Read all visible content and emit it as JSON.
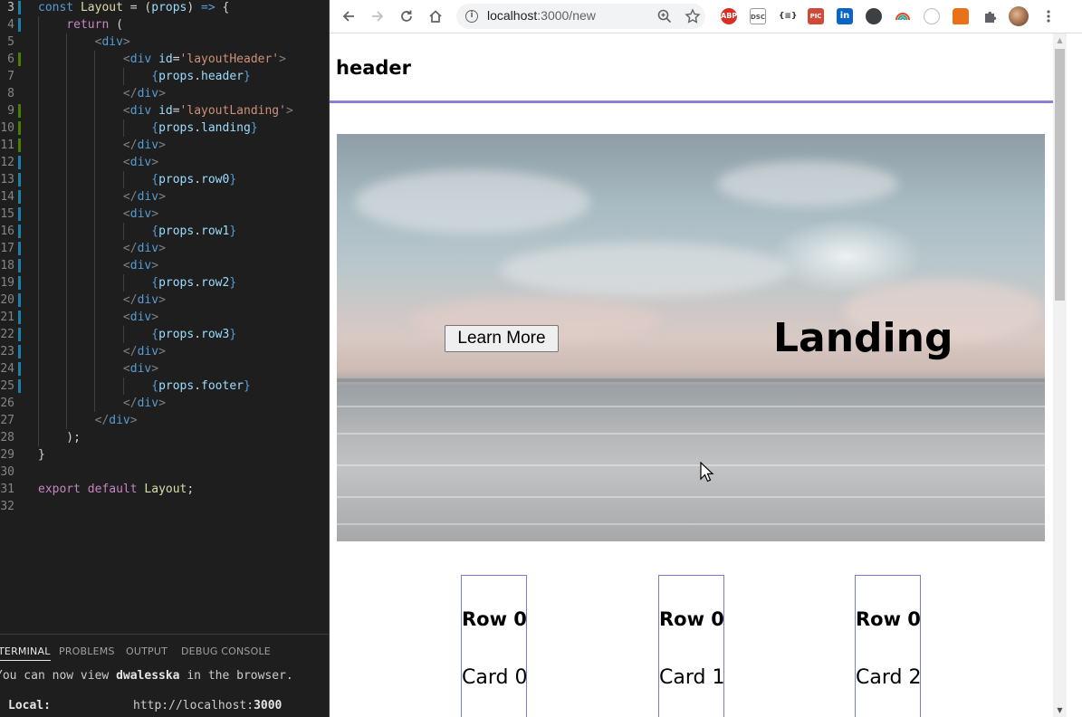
{
  "editor": {
    "lines": [
      {
        "num": "3",
        "html": "<span class='kw-blue'>const</span> <span class='fn'>Layout</span> = (<span class='var'>props</span>) <span class='kw-blue'>=&gt;</span> {"
      },
      {
        "num": "4",
        "html": "    <span class='kw-purple'>return</span> ("
      },
      {
        "num": "5",
        "html": "        <span class='punct'>&lt;</span><span class='tag'>div</span><span class='punct'>&gt;</span>"
      },
      {
        "num": "6",
        "html": "            <span class='punct'>&lt;</span><span class='tag'>div</span> <span class='attr'>id</span>=<span class='str'>'layoutHeader'</span><span class='punct'>&gt;</span>"
      },
      {
        "num": "7",
        "html": "                <span class='jsx-brace'>{</span><span class='var'>props</span>.<span class='var'>header</span><span class='jsx-brace'>}</span>"
      },
      {
        "num": "8",
        "html": "            <span class='punct'>&lt;/</span><span class='tag'>div</span><span class='punct'>&gt;</span>"
      },
      {
        "num": "9",
        "html": "            <span class='punct'>&lt;</span><span class='tag'>div</span> <span class='attr'>id</span>=<span class='str'>'layoutLanding'</span><span class='punct'>&gt;</span>"
      },
      {
        "num": "10",
        "html": "                <span class='jsx-brace'>{</span><span class='var'>props</span>.<span class='var'>landing</span><span class='jsx-brace'>}</span>"
      },
      {
        "num": "11",
        "html": "            <span class='punct'>&lt;/</span><span class='tag'>div</span><span class='punct'>&gt;</span>"
      },
      {
        "num": "12",
        "html": "            <span class='punct'>&lt;</span><span class='tag'>div</span><span class='punct'>&gt;</span>"
      },
      {
        "num": "13",
        "html": "                <span class='jsx-brace'>{</span><span class='var'>props</span>.<span class='var'>row0</span><span class='jsx-brace'>}</span>"
      },
      {
        "num": "14",
        "html": "            <span class='punct'>&lt;/</span><span class='tag'>div</span><span class='punct'>&gt;</span>"
      },
      {
        "num": "15",
        "html": "            <span class='punct'>&lt;</span><span class='tag'>div</span><span class='punct'>&gt;</span>"
      },
      {
        "num": "16",
        "html": "                <span class='jsx-brace'>{</span><span class='var'>props</span>.<span class='var'>row1</span><span class='jsx-brace'>}</span>"
      },
      {
        "num": "17",
        "html": "            <span class='punct'>&lt;/</span><span class='tag'>div</span><span class='punct'>&gt;</span>"
      },
      {
        "num": "18",
        "html": "            <span class='punct'>&lt;</span><span class='tag'>div</span><span class='punct'>&gt;</span>"
      },
      {
        "num": "19",
        "html": "                <span class='jsx-brace'>{</span><span class='var'>props</span>.<span class='var'>row2</span><span class='jsx-brace'>}</span>"
      },
      {
        "num": "20",
        "html": "            <span class='punct'>&lt;/</span><span class='tag'>div</span><span class='punct'>&gt;</span>"
      },
      {
        "num": "21",
        "html": "            <span class='punct'>&lt;</span><span class='tag'>div</span><span class='punct'>&gt;</span>"
      },
      {
        "num": "22",
        "html": "                <span class='jsx-brace'>{</span><span class='var'>props</span>.<span class='var'>row3</span><span class='jsx-brace'>}</span>"
      },
      {
        "num": "23",
        "html": "            <span class='punct'>&lt;/</span><span class='tag'>div</span><span class='punct'>&gt;</span>"
      },
      {
        "num": "24",
        "html": "            <span class='punct'>&lt;</span><span class='tag'>div</span><span class='punct'>&gt;</span>"
      },
      {
        "num": "25",
        "html": "                <span class='jsx-brace'>{</span><span class='var'>props</span>.<span class='var'>footer</span><span class='jsx-brace'>}</span>"
      },
      {
        "num": "26",
        "html": "            <span class='punct'>&lt;/</span><span class='tag'>div</span><span class='punct'>&gt;</span>"
      },
      {
        "num": "27",
        "html": "        <span class='punct'>&lt;/</span><span class='tag'>div</span><span class='punct'>&gt;</span>"
      },
      {
        "num": "28",
        "html": "    );"
      },
      {
        "num": "29",
        "html": "}"
      },
      {
        "num": "30",
        "html": ""
      },
      {
        "num": "31",
        "html": "<span class='kw-purple'>export</span> <span class='kw-purple'>default</span> <span class='fn'>Layout</span>;"
      },
      {
        "num": "32",
        "html": ""
      }
    ]
  },
  "panel": {
    "tabs": [
      "TERMINAL",
      "PROBLEMS",
      "OUTPUT",
      "DEBUG CONSOLE"
    ],
    "active_tab": "TERMINAL",
    "line1_prefix": "You can now view ",
    "line1_bold": "dwalesska",
    "line1_suffix": " in the browser.",
    "local_label": "Local:",
    "local_url_prefix": "http://localhost:",
    "local_url_port": "3000"
  },
  "browser": {
    "url_host": "localhost",
    "url_rest": ":3000/new",
    "extensions": [
      "ABP",
      "DSC",
      "{≡}",
      "PIC",
      "in"
    ],
    "colors": {
      "accent_rule": "#8f7ed6",
      "card_border": "#7b7bd0"
    }
  },
  "page": {
    "header": "header",
    "landing_title": "Landing",
    "learn_more": "Learn More",
    "cards": [
      {
        "title": "Row 0",
        "subtitle": "Card 0"
      },
      {
        "title": "Row 0",
        "subtitle": "Card 1"
      },
      {
        "title": "Row 0",
        "subtitle": "Card 2"
      }
    ]
  }
}
